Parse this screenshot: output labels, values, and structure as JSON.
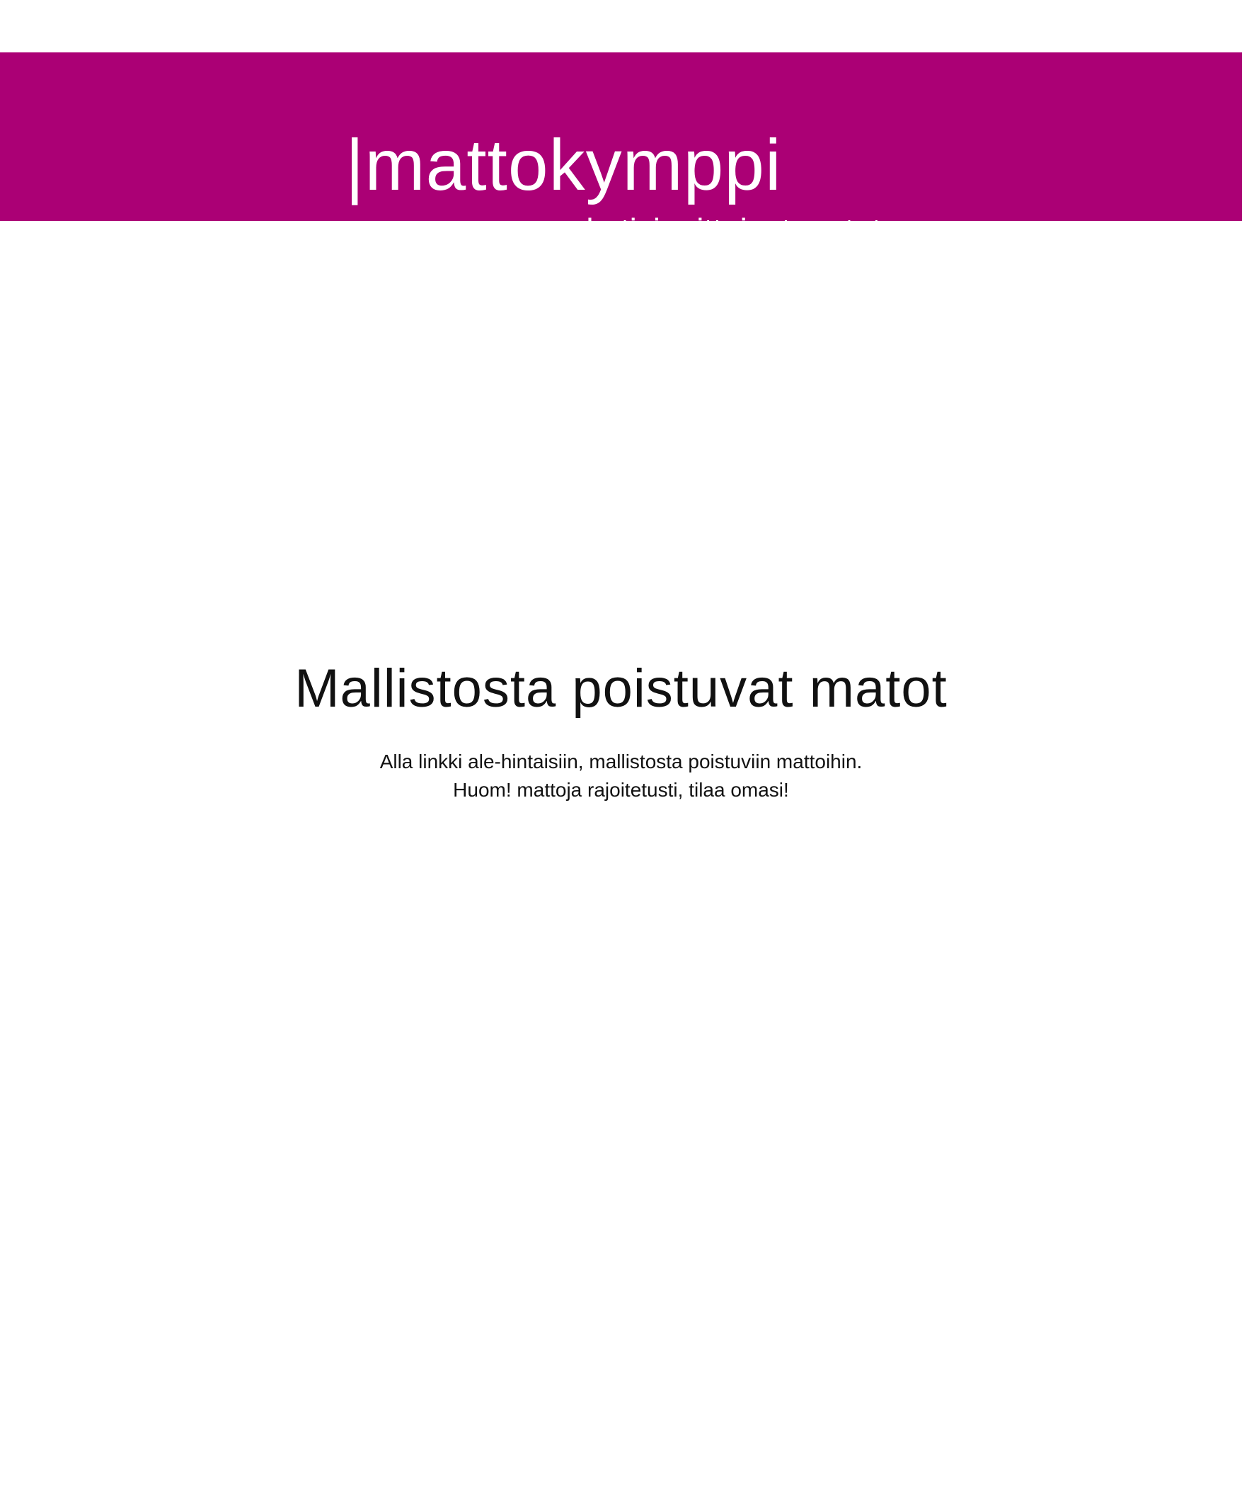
{
  "header": {
    "brand_name": "|mattokymppi",
    "tagline": "- kotisi mittaiset matot",
    "background_color": "#ab0075"
  },
  "main": {
    "title": "Mallistosta poistuvat matot",
    "intro_lines": [
      "Alla linkki ale-hintaisiin, mallistosta poistuviin mattoihin.",
      "Huom! mattoja rajoitetusti, tilaa omasi!"
    ]
  }
}
